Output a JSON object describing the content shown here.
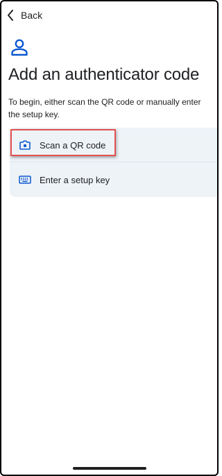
{
  "nav": {
    "back_label": "Back",
    "back_icon": "chevron-left-icon"
  },
  "header": {
    "icon": "person-icon",
    "title": "Add an authenticator code",
    "intro": "To begin, either scan the QR code or manually enter the setup key."
  },
  "options": [
    {
      "label": "Scan a QR code",
      "icon": "camera-icon",
      "highlighted": true
    },
    {
      "label": "Enter a setup key",
      "icon": "keyboard-icon",
      "highlighted": false
    }
  ],
  "colors": {
    "accent": "#0b57d0",
    "card_background": "#eef3f8",
    "highlight_border": "#e3504f",
    "text": "#202124"
  }
}
